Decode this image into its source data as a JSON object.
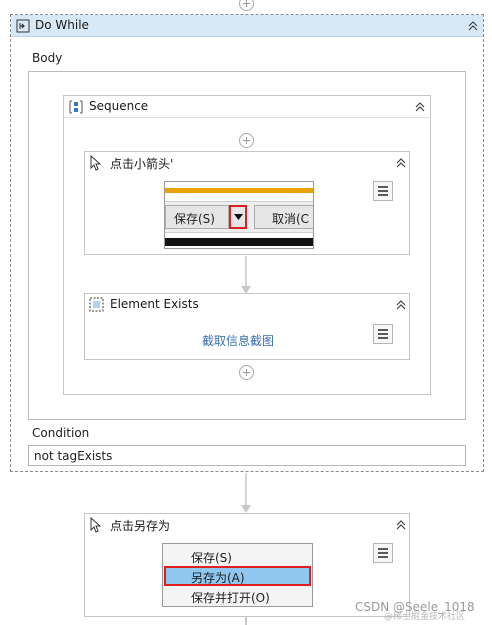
{
  "do_while": {
    "title": "Do While",
    "body_label": "Body",
    "condition_label": "Condition",
    "condition_value": "not tagExists"
  },
  "sequence": {
    "title": "Sequence"
  },
  "click_arrow": {
    "title": "点击小箭头'",
    "thumb": {
      "save_label": "保存(S)",
      "cancel_label": "取消(C"
    }
  },
  "element_exists": {
    "title": "Element Exists",
    "link_text": "截取信息截图"
  },
  "click_saveas": {
    "title": "点击另存为",
    "menu_items": [
      "保存(S)",
      "另存为(A)",
      "保存并打开(O)"
    ]
  },
  "watermark": {
    "text": "CSDN @Seele_1018",
    "subtext": "@稀土掘金技术社区"
  },
  "icons": [
    "add-icon",
    "loop-icon",
    "sequence-icon",
    "pointer-icon",
    "element-exists-icon",
    "collapse-icon",
    "menu-icon",
    "dropdown-arrow-icon"
  ],
  "colors": {
    "header_bg": "#d7e9f7",
    "selection_bg": "#8fc7f0",
    "highlight_border": "#e02020",
    "accent_bar": "#e8a20a"
  }
}
